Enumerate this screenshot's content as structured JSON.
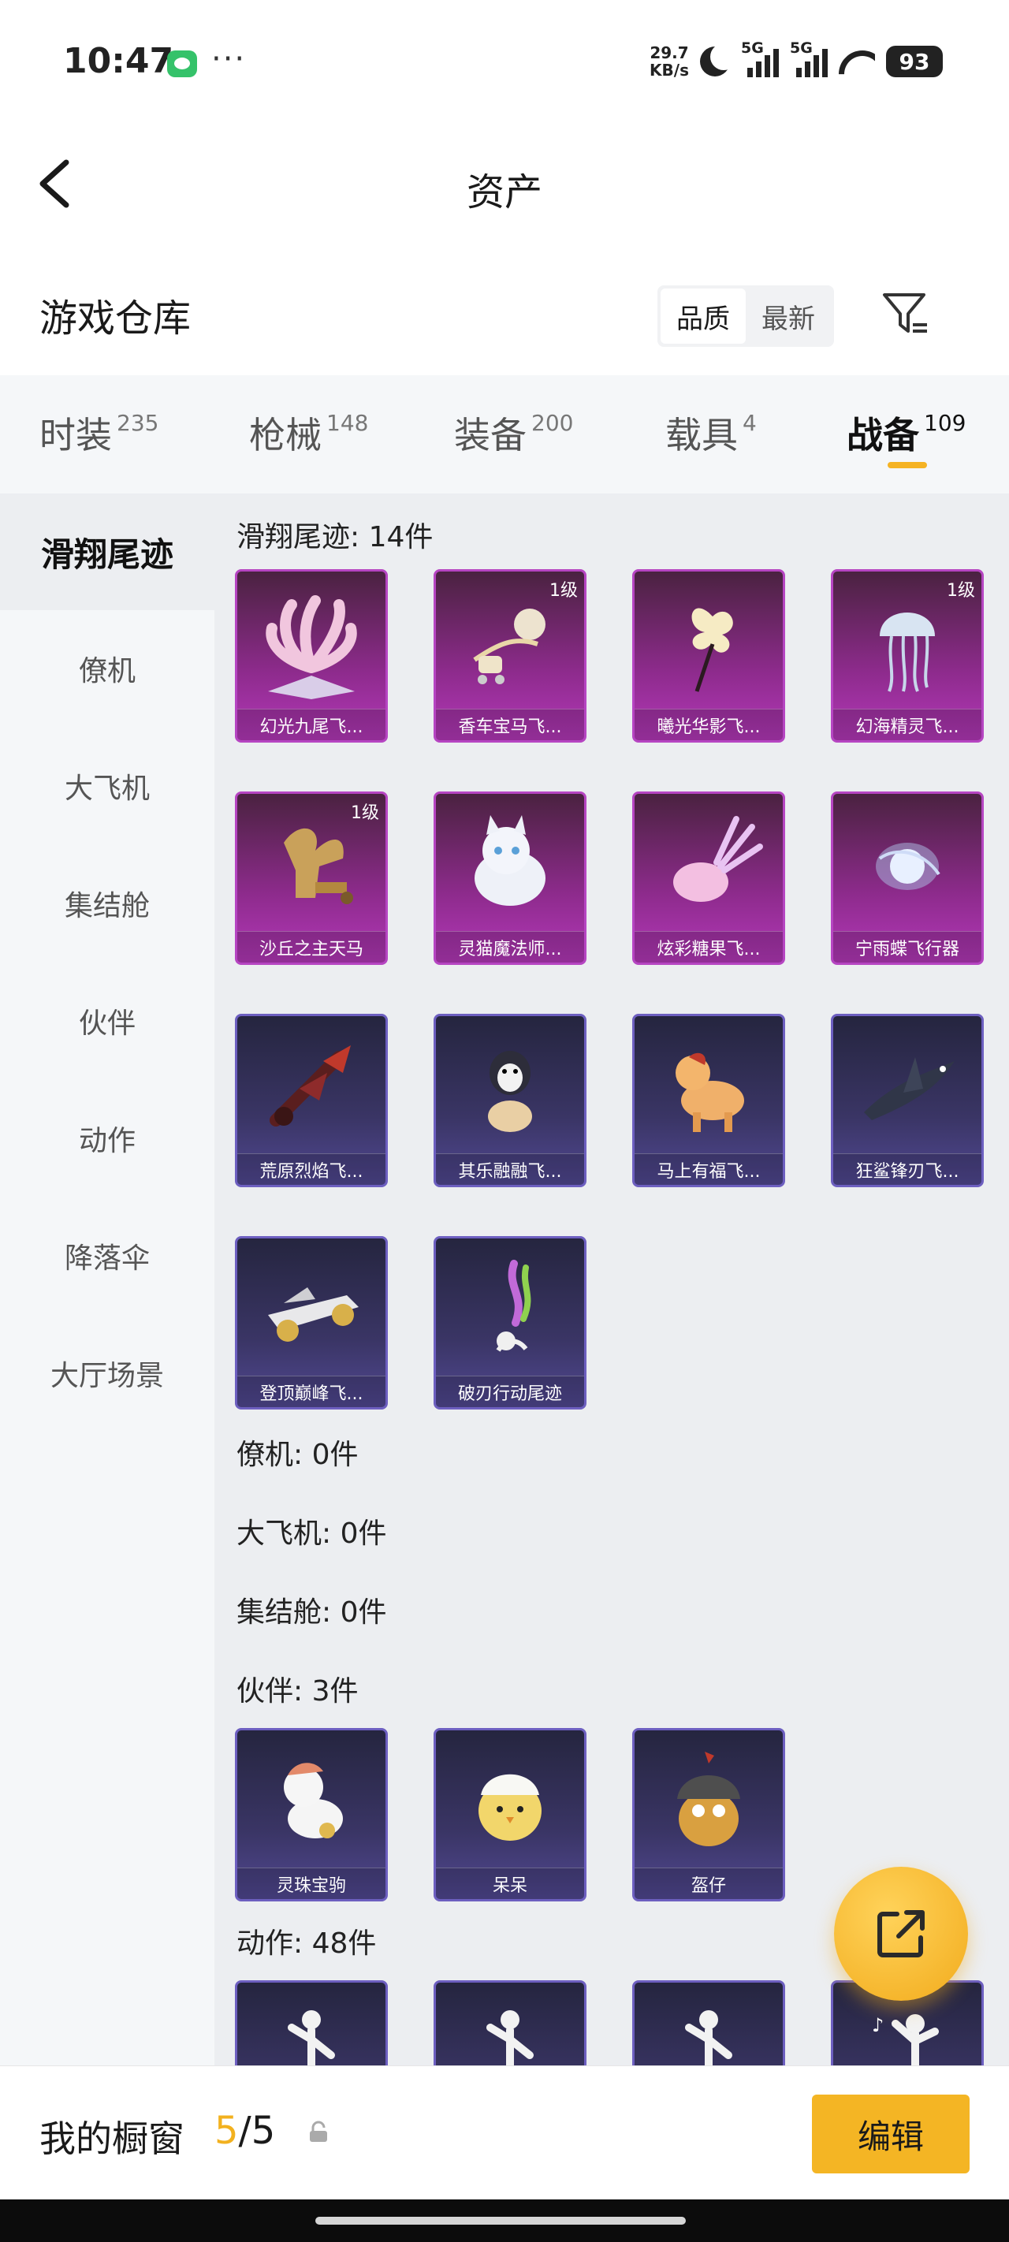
{
  "status_bar": {
    "time": "10:47",
    "net_speed_value": "29.7",
    "net_speed_unit": "KB/s",
    "sim1": "5G",
    "sim2": "5G",
    "battery": "93",
    "wechat_icon": "wechat-icon",
    "more_glyph": "···"
  },
  "header": {
    "title": "资产",
    "back_icon": "back-arrow-icon"
  },
  "section": {
    "title": "游戏仓库",
    "sort_options": [
      "品质",
      "最新"
    ],
    "active_sort": "品质",
    "filter_icon": "filter-icon"
  },
  "tabs": [
    {
      "name": "时装",
      "count": "235"
    },
    {
      "name": "枪械",
      "count": "148"
    },
    {
      "name": "装备",
      "count": "200"
    },
    {
      "name": "载具",
      "count": "4"
    },
    {
      "name": "战备",
      "count": "109",
      "active": true
    }
  ],
  "sidebar": [
    {
      "label": "滑翔尾迹",
      "active": true
    },
    {
      "label": "僚机"
    },
    {
      "label": "大飞机"
    },
    {
      "label": "集结舱"
    },
    {
      "label": "伙伴"
    },
    {
      "label": "动作"
    },
    {
      "label": "降落伞"
    },
    {
      "label": "大厅场景"
    }
  ],
  "groups": {
    "glide": "滑翔尾迹: 14件",
    "wingman": "僚机: 0件",
    "plane": "大飞机: 0件",
    "pod": "集结舱: 0件",
    "partner": "伙伴: 3件",
    "emote": "动作: 48件"
  },
  "glide_items": [
    {
      "name": "幻光九尾飞...",
      "level": "",
      "quality": "pink",
      "icon": "nine-tail-fox-icon"
    },
    {
      "name": "香车宝马飞...",
      "level": "1级",
      "quality": "pink",
      "icon": "carriage-icon"
    },
    {
      "name": "曦光华影飞...",
      "level": "",
      "quality": "pink",
      "icon": "flower-icon"
    },
    {
      "name": "幻海精灵飞...",
      "level": "1级",
      "quality": "pink",
      "icon": "jellyfish-icon"
    },
    {
      "name": "沙丘之主天马",
      "level": "1级",
      "quality": "pink",
      "icon": "pegasus-icon"
    },
    {
      "name": "灵猫魔法师...",
      "level": "",
      "quality": "pink",
      "icon": "cat-icon"
    },
    {
      "name": "炫彩糖果飞...",
      "level": "",
      "quality": "pink",
      "icon": "candy-icon"
    },
    {
      "name": "宁雨蝶飞行器",
      "level": "",
      "quality": "pink",
      "icon": "orb-icon"
    },
    {
      "name": "荒原烈焰飞...",
      "level": "",
      "quality": "blue",
      "icon": "flame-wing-icon"
    },
    {
      "name": "其乐融融飞...",
      "level": "",
      "quality": "blue",
      "icon": "penguin-icon"
    },
    {
      "name": "马上有福飞...",
      "level": "",
      "quality": "blue",
      "icon": "horse-icon"
    },
    {
      "name": "狂鲨锋刃飞...",
      "level": "",
      "quality": "blue",
      "icon": "shark-icon"
    },
    {
      "name": "登顶巅峰飞...",
      "level": "",
      "quality": "blue",
      "icon": "jet-icon"
    },
    {
      "name": "破刃行动尾迹",
      "level": "",
      "quality": "blue",
      "icon": "smoke-trail-icon"
    }
  ],
  "partner_items": [
    {
      "name": "灵珠宝驹",
      "quality": "blue",
      "icon": "pony-icon"
    },
    {
      "name": "呆呆",
      "quality": "blue",
      "icon": "chick-icon"
    },
    {
      "name": "盔仔",
      "quality": "blue",
      "icon": "helmet-chick-icon"
    }
  ],
  "emote_items": [
    {
      "quality": "blue",
      "icon": "dance-pose-icon"
    },
    {
      "quality": "blue",
      "icon": "dance-pose-icon"
    },
    {
      "quality": "blue",
      "icon": "dance-pose-icon"
    },
    {
      "quality": "blue",
      "icon": "music-dance-icon"
    }
  ],
  "fab": {
    "icon": "share-external-icon"
  },
  "bottom": {
    "title": "我的橱窗",
    "count_current": "5",
    "count_sep_total": "/5",
    "lock_icon": "lock-icon",
    "edit_label": "编辑"
  },
  "colors": {
    "accent": "#f4b524",
    "pink_card": "#b338b8",
    "blue_card": "#514892"
  }
}
